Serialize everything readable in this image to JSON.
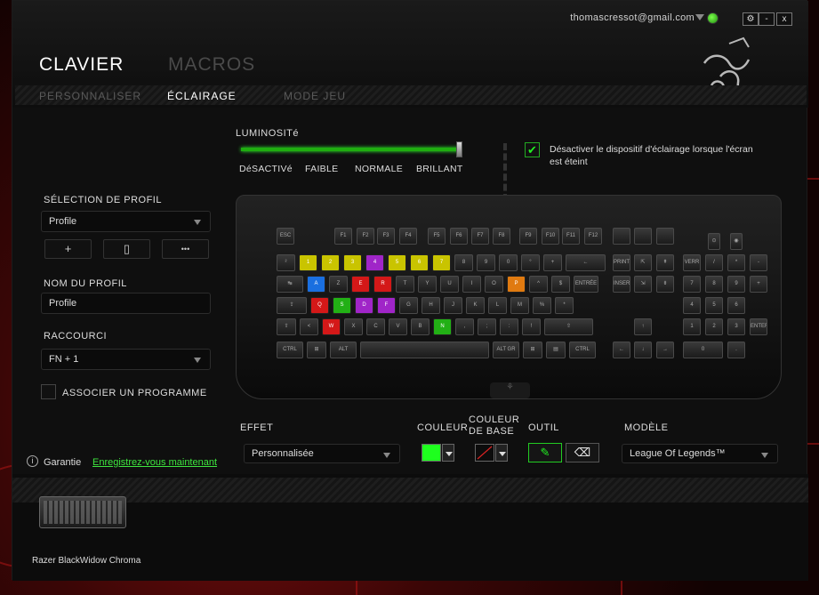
{
  "header": {
    "email": "thomascressot@gmail.com",
    "win_settings": "⚙",
    "win_min": "-",
    "win_close": "x"
  },
  "nav": {
    "main": [
      "CLAVIER",
      "MACROS"
    ],
    "sub": [
      "PERSONNALISER",
      "ÉCLAIRAGE",
      "MODE JEU"
    ]
  },
  "sidebar": {
    "profile_label": "SÉLECTION DE PROFIL",
    "profile_value": "Profile",
    "btn_add": "+",
    "btn_delete": "▯",
    "btn_more": "•••",
    "name_label": "NOM DU PROFIL",
    "name_value": "Profile",
    "shortcut_label": "RACCOURCI",
    "shortcut_value": "FN + 1",
    "associate_label": "ASSOCIER UN PROGRAMME",
    "warranty_label": "Garantie",
    "warranty_link": "Enregistrez-vous maintenant"
  },
  "brightness": {
    "label": "LUMINOSITé",
    "level": 1.0,
    "marks": [
      "DéSACTIVé",
      "FAIBLE",
      "NORMALE",
      "BRILLANT"
    ]
  },
  "disable_lighting": {
    "checked": true,
    "text": "Désactiver le dispositif d'éclairage lorsque l'écran est éteint"
  },
  "controls": {
    "effect_label": "EFFET",
    "effect_value": "Personnalisée",
    "color_label": "COULEUR",
    "color_value": "#1eff1e",
    "base_color_label": "COULEUR DE BASE",
    "tool_label": "OUTIL",
    "model_label": "MODÈLE",
    "model_value": "League Of Legends™"
  },
  "device": {
    "name": "Razer BlackWidow Chroma"
  },
  "keyboard": {
    "fn_row": [
      "ESC",
      "F1",
      "F2",
      "F3",
      "F4",
      "F5",
      "F6",
      "F7",
      "F8",
      "F9",
      "F10",
      "F11",
      "F12"
    ],
    "colors": {
      "yellow": "#c9c400",
      "blue": "#1a6fe0",
      "red": "#d41818",
      "green": "#22b015",
      "purple": "#a025c8",
      "orange": "#e07a10",
      "teal": "#18b0b0",
      "pink": "#d02070"
    },
    "row1": [
      "²",
      "1",
      "2",
      "3",
      "4",
      "5",
      "6",
      "7",
      "8",
      "9",
      "0",
      "°",
      "+",
      "←"
    ],
    "row2": [
      "↹",
      "A",
      "Z",
      "E",
      "R",
      "T",
      "Y",
      "U",
      "I",
      "O",
      "P",
      "^",
      "$",
      "ENTRÉE"
    ],
    "row3": [
      "⇪",
      "Q",
      "S",
      "D",
      "F",
      "G",
      "H",
      "J",
      "K",
      "L",
      "M",
      "%",
      "*"
    ],
    "row4": [
      "⇧",
      "<",
      "W",
      "X",
      "C",
      "V",
      "B",
      "N",
      ",",
      ";",
      ":",
      "!",
      "⇧"
    ],
    "row5": [
      "CTRL",
      "⊞",
      "ALT",
      "",
      "ALT GR",
      "⊞",
      "▤",
      "CTRL"
    ],
    "nav": [
      "PRINT",
      "⇱",
      "⇞",
      "INSERT",
      "⇲",
      "⇟"
    ],
    "arrows": [
      "↑",
      "←",
      "↓",
      "→"
    ],
    "numpad": [
      "VERR",
      "/",
      "*",
      "-",
      "7",
      "8",
      "9",
      "+",
      "4",
      "5",
      "6",
      "1",
      "2",
      "3",
      "ENTER",
      "0",
      "."
    ]
  }
}
